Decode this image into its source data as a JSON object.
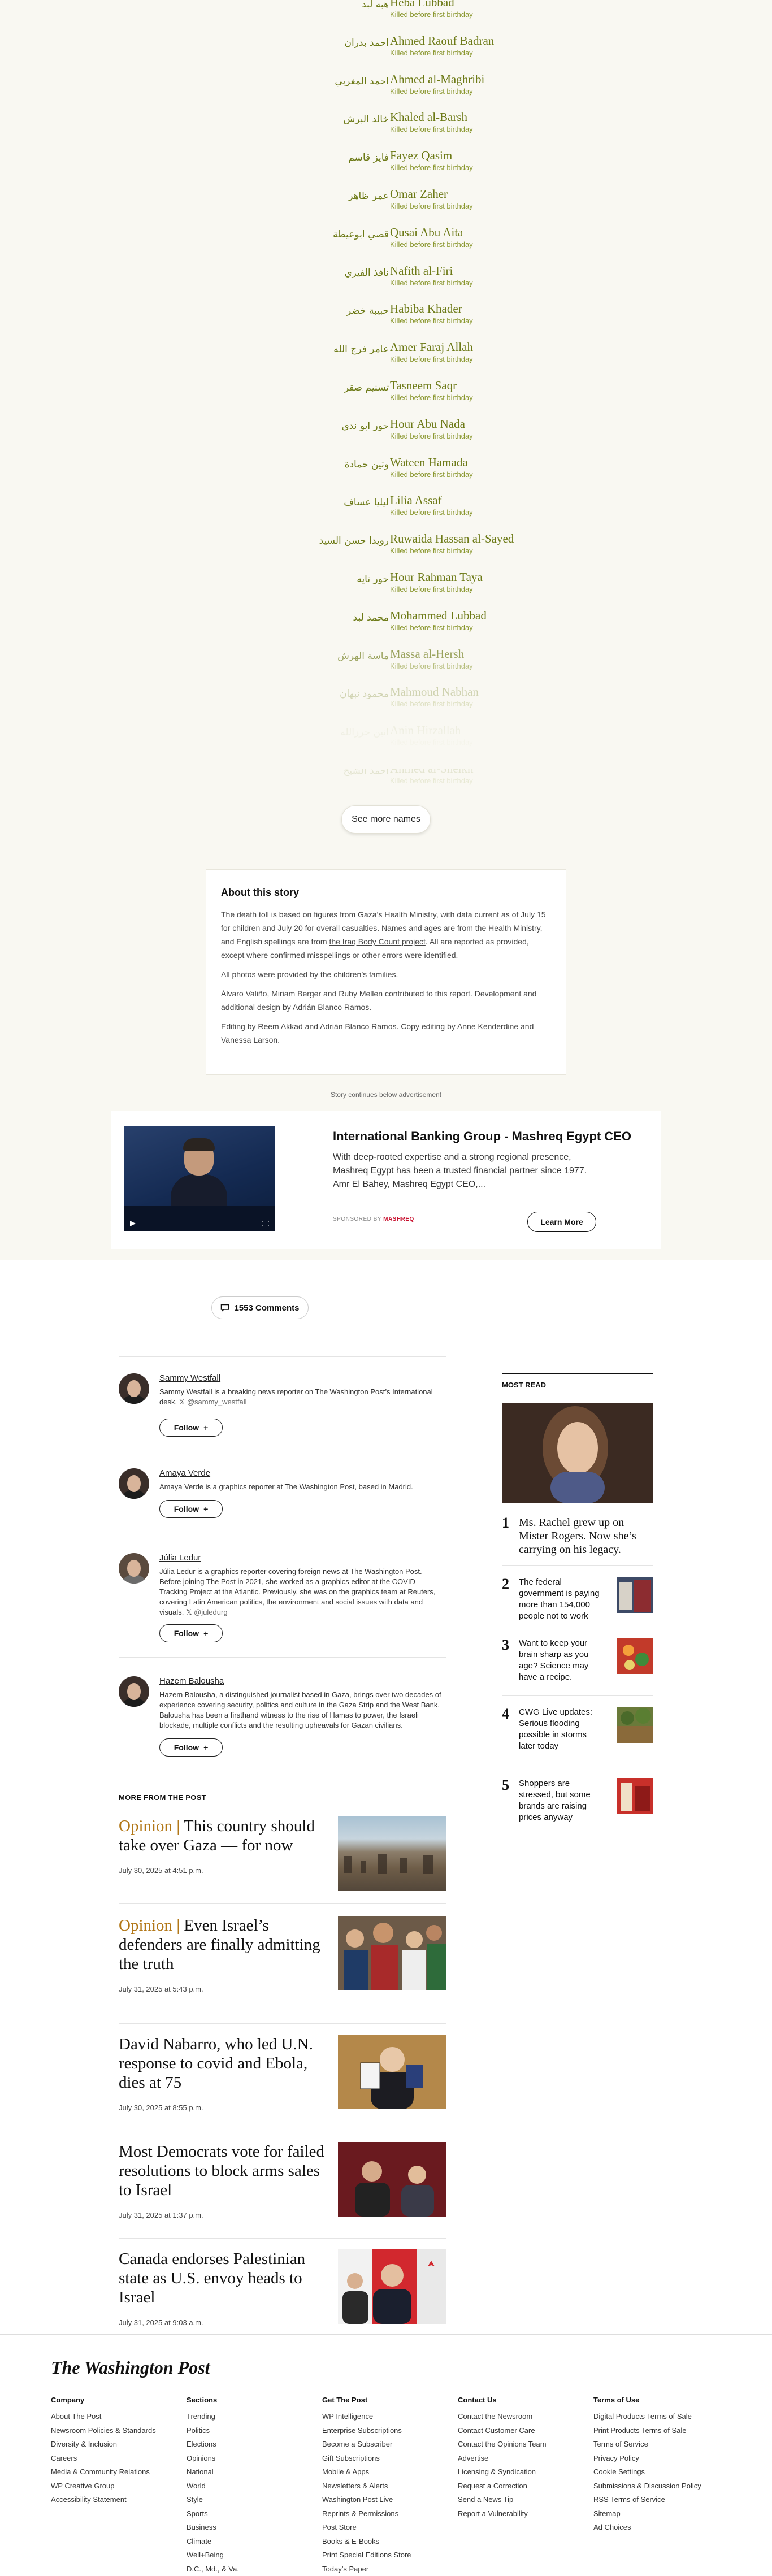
{
  "memorial": {
    "status_text": "Killed before first birthday",
    "names": [
      {
        "en": "Heba Lubbad",
        "ar": "هبه لبد"
      },
      {
        "en": "Ahmed Raouf Badran",
        "ar": "احمد بدران"
      },
      {
        "en": "Ahmed al-Maghribi",
        "ar": "احمد المغربي"
      },
      {
        "en": "Khaled al-Barsh",
        "ar": "خالد البرش"
      },
      {
        "en": "Fayez Qasim",
        "ar": "فايز قاسم"
      },
      {
        "en": "Omar Zaher",
        "ar": "عمر ظاهر"
      },
      {
        "en": "Qusai Abu Aita",
        "ar": "قصي ابوعيطة"
      },
      {
        "en": "Nafith al-Firi",
        "ar": "نافذ الفيري"
      },
      {
        "en": "Habiba Khader",
        "ar": "حبيبة خضر"
      },
      {
        "en": "Amer Faraj Allah",
        "ar": "عامر فرج الله"
      },
      {
        "en": "Tasneem Saqr",
        "ar": "تسنيم صقر"
      },
      {
        "en": "Hour Abu Nada",
        "ar": "حور ابو ندى"
      },
      {
        "en": "Wateen Hamada",
        "ar": "وتين حمادة"
      },
      {
        "en": "Lilia Assaf",
        "ar": "ليليا عساف"
      },
      {
        "en": "Ruwaida Hassan al-Sayed",
        "ar": "رويدا حسن السيد"
      },
      {
        "en": "Hour Rahman Taya",
        "ar": "حور تايه"
      },
      {
        "en": "Mohammed Lubbad",
        "ar": "محمد لبد"
      },
      {
        "en": "Massa al-Hersh",
        "ar": "ماسة الهرش"
      },
      {
        "en": "Mahmoud Nabhan",
        "ar": "محمود نبهان"
      },
      {
        "en": "Anin Hirzallah",
        "ar": "انين حرزالله"
      },
      {
        "en": "Ahmed al-Sheikh",
        "ar": "احمد الشيخ"
      }
    ],
    "see_more_label": "See more names"
  },
  "about": {
    "heading": "About this story",
    "p1_before": "The death toll is based on figures from Gaza’s Health Ministry, with data current as of July 15 for children and July 20 for overall casualties. Names and ages are from the Health Ministry, and English spellings are from ",
    "p1_link": "the Iraq Body Count project",
    "p1_after": ". All are reported as provided, except where confirmed misspellings or other errors were identified.",
    "p2": "All photos were provided by the children’s families.",
    "p3": "Álvaro Valiño, Miriam Berger and Ruby Mellen contributed to this report. Development and additional design by Adrián Blanco Ramos.",
    "p4": "Editing by Reem Akkad and Adrián Blanco Ramos. Copy editing by Anne Kenderdine and Vanessa Larson."
  },
  "ad": {
    "notice": "Story continues below advertisement",
    "title": "International Banking Group - Mashreq Egypt CEO",
    "text": "With deep-rooted expertise and a strong regional presence, Mashreq Egypt has been a trusted financial partner since 1977. Amr El Bahey, Mashreq Egypt CEO,...",
    "sponsor_prefix": "SPONSORED BY",
    "sponsor_name": "MASHREQ",
    "cta": "Learn More"
  },
  "comments": {
    "label": "1553 Comments"
  },
  "authors": [
    {
      "name": "Sammy Westfall",
      "bio": "Sammy Westfall is a breaking news reporter on The Washington Post’s International desk.",
      "handle": "@sammy_westfall",
      "follow": "Follow"
    },
    {
      "name": "Amaya Verde",
      "bio": "Amaya Verde is a graphics reporter at The Washington Post, based in Madrid.",
      "handle": "",
      "follow": "Follow"
    },
    {
      "name": "Júlia Ledur",
      "bio": "Júlia Ledur is a graphics reporter covering foreign news at The Washington Post. Before joining The Post in 2021, she worked as a graphics editor at the COVID Tracking Project at the Atlantic. Previously, she was on the graphics team at Reuters, covering Latin American politics, the environment and social issues with data and visuals.",
      "handle": "@juledurg",
      "follow": "Follow"
    },
    {
      "name": "Hazem Balousha",
      "bio": "Hazem Balousha, a distinguished journalist based in Gaza, brings over two decades of experience covering security, politics and culture in the Gaza Strip and the West Bank. Balousha has been a firsthand witness to the rise of Hamas to power, the Israeli blockade, multiple conflicts and the resulting upheavals for Gazan civilians.",
      "handle": "",
      "follow": "Follow"
    }
  ],
  "more": {
    "heading": "MORE FROM THE POST",
    "stories": [
      {
        "kicker": "Opinion",
        "title": "This country should take over Gaza — for now",
        "date": "July 30, 2025 at 4:51 p.m."
      },
      {
        "kicker": "Opinion",
        "title": "Even Israel’s defenders are finally admitting the truth",
        "date": "July 31, 2025 at 5:43 p.m."
      },
      {
        "kicker": "",
        "title": "David Nabarro, who led U.N. response to covid and Ebola, dies at 75",
        "date": "July 30, 2025 at 8:55 p.m."
      },
      {
        "kicker": "",
        "title": "Most Democrats vote for failed resolutions to block arms sales to Israel",
        "date": "July 31, 2025 at 1:37 p.m."
      },
      {
        "kicker": "",
        "title": "Canada endorses Palestinian state as U.S. envoy heads to Israel",
        "date": "July 31, 2025 at 9:03 a.m."
      }
    ]
  },
  "most_read": {
    "heading": "MOST READ",
    "items": [
      {
        "num": "1",
        "title": "Ms. Rachel grew up on Mister Rogers. Now she’s carrying on his legacy."
      },
      {
        "num": "2",
        "title": "The federal government is paying more than 154,000 people not to work"
      },
      {
        "num": "3",
        "title": "Want to keep your brain sharp as you age? Science may have a recipe."
      },
      {
        "num": "4",
        "title": "CWG Live updates: Serious flooding possible in storms later today"
      },
      {
        "num": "5",
        "title": "Shoppers are stressed, but some brands are raising prices anyway"
      }
    ]
  },
  "footer": {
    "logo": "The Washington Post",
    "columns": [
      {
        "heading": "Company",
        "links": [
          "About The Post",
          "Newsroom Policies & Standards",
          "Diversity & Inclusion",
          "Careers",
          "Media & Community Relations",
          "WP Creative Group",
          "Accessibility Statement"
        ]
      },
      {
        "heading": "Sections",
        "links": [
          "Trending",
          "Politics",
          "Elections",
          "Opinions",
          "National",
          "World",
          "Style",
          "Sports",
          "Business",
          "Climate",
          "Well+Being",
          "D.C., Md., & Va."
        ]
      },
      {
        "heading": "Get The Post",
        "links": [
          "WP Intelligence",
          "Enterprise Subscriptions",
          "Become a Subscriber",
          "Gift Subscriptions",
          "Mobile & Apps",
          "Newsletters & Alerts",
          "Washington Post Live",
          "Reprints & Permissions",
          "Post Store",
          "Books & E-Books",
          "Print Special Editions Store",
          "Today’s Paper"
        ]
      },
      {
        "heading": "Contact Us",
        "links": [
          "Contact the Newsroom",
          "Contact Customer Care",
          "Contact the Opinions Team",
          "Advertise",
          "Licensing & Syndication",
          "Request a Correction",
          "Send a News Tip",
          "Report a Vulnerability"
        ]
      },
      {
        "heading": "Terms of Use",
        "links": [
          "Digital Products Terms of Sale",
          "Print Products Terms of Sale",
          "Terms of Service",
          "Privacy Policy",
          "Cookie Settings",
          "Submissions & Discussion Policy",
          "RSS Terms of Service",
          "Sitemap",
          "Ad Choices"
        ]
      }
    ]
  }
}
